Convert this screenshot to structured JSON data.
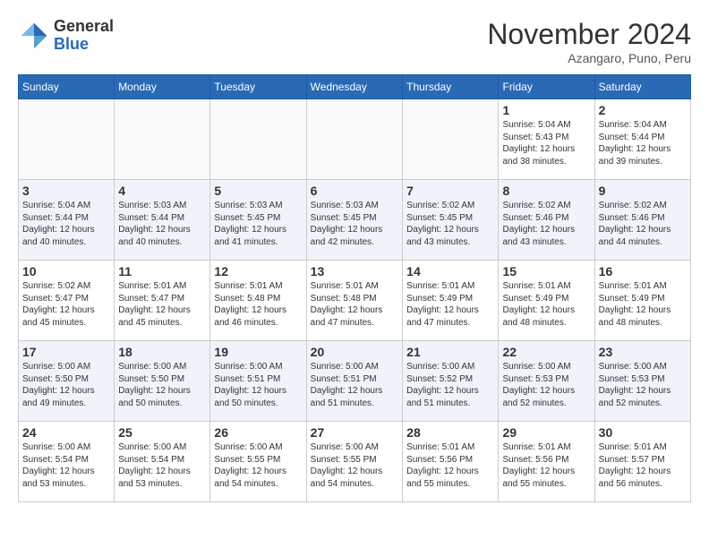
{
  "logo": {
    "general": "General",
    "blue": "Blue"
  },
  "title": "November 2024",
  "location": "Azangaro, Puno, Peru",
  "days_of_week": [
    "Sunday",
    "Monday",
    "Tuesday",
    "Wednesday",
    "Thursday",
    "Friday",
    "Saturday"
  ],
  "weeks": [
    [
      {
        "day": "",
        "info": ""
      },
      {
        "day": "",
        "info": ""
      },
      {
        "day": "",
        "info": ""
      },
      {
        "day": "",
        "info": ""
      },
      {
        "day": "",
        "info": ""
      },
      {
        "day": "1",
        "info": "Sunrise: 5:04 AM\nSunset: 5:43 PM\nDaylight: 12 hours and 38 minutes."
      },
      {
        "day": "2",
        "info": "Sunrise: 5:04 AM\nSunset: 5:44 PM\nDaylight: 12 hours and 39 minutes."
      }
    ],
    [
      {
        "day": "3",
        "info": "Sunrise: 5:04 AM\nSunset: 5:44 PM\nDaylight: 12 hours and 40 minutes."
      },
      {
        "day": "4",
        "info": "Sunrise: 5:03 AM\nSunset: 5:44 PM\nDaylight: 12 hours and 40 minutes."
      },
      {
        "day": "5",
        "info": "Sunrise: 5:03 AM\nSunset: 5:45 PM\nDaylight: 12 hours and 41 minutes."
      },
      {
        "day": "6",
        "info": "Sunrise: 5:03 AM\nSunset: 5:45 PM\nDaylight: 12 hours and 42 minutes."
      },
      {
        "day": "7",
        "info": "Sunrise: 5:02 AM\nSunset: 5:45 PM\nDaylight: 12 hours and 43 minutes."
      },
      {
        "day": "8",
        "info": "Sunrise: 5:02 AM\nSunset: 5:46 PM\nDaylight: 12 hours and 43 minutes."
      },
      {
        "day": "9",
        "info": "Sunrise: 5:02 AM\nSunset: 5:46 PM\nDaylight: 12 hours and 44 minutes."
      }
    ],
    [
      {
        "day": "10",
        "info": "Sunrise: 5:02 AM\nSunset: 5:47 PM\nDaylight: 12 hours and 45 minutes."
      },
      {
        "day": "11",
        "info": "Sunrise: 5:01 AM\nSunset: 5:47 PM\nDaylight: 12 hours and 45 minutes."
      },
      {
        "day": "12",
        "info": "Sunrise: 5:01 AM\nSunset: 5:48 PM\nDaylight: 12 hours and 46 minutes."
      },
      {
        "day": "13",
        "info": "Sunrise: 5:01 AM\nSunset: 5:48 PM\nDaylight: 12 hours and 47 minutes."
      },
      {
        "day": "14",
        "info": "Sunrise: 5:01 AM\nSunset: 5:49 PM\nDaylight: 12 hours and 47 minutes."
      },
      {
        "day": "15",
        "info": "Sunrise: 5:01 AM\nSunset: 5:49 PM\nDaylight: 12 hours and 48 minutes."
      },
      {
        "day": "16",
        "info": "Sunrise: 5:01 AM\nSunset: 5:49 PM\nDaylight: 12 hours and 48 minutes."
      }
    ],
    [
      {
        "day": "17",
        "info": "Sunrise: 5:00 AM\nSunset: 5:50 PM\nDaylight: 12 hours and 49 minutes."
      },
      {
        "day": "18",
        "info": "Sunrise: 5:00 AM\nSunset: 5:50 PM\nDaylight: 12 hours and 50 minutes."
      },
      {
        "day": "19",
        "info": "Sunrise: 5:00 AM\nSunset: 5:51 PM\nDaylight: 12 hours and 50 minutes."
      },
      {
        "day": "20",
        "info": "Sunrise: 5:00 AM\nSunset: 5:51 PM\nDaylight: 12 hours and 51 minutes."
      },
      {
        "day": "21",
        "info": "Sunrise: 5:00 AM\nSunset: 5:52 PM\nDaylight: 12 hours and 51 minutes."
      },
      {
        "day": "22",
        "info": "Sunrise: 5:00 AM\nSunset: 5:53 PM\nDaylight: 12 hours and 52 minutes."
      },
      {
        "day": "23",
        "info": "Sunrise: 5:00 AM\nSunset: 5:53 PM\nDaylight: 12 hours and 52 minutes."
      }
    ],
    [
      {
        "day": "24",
        "info": "Sunrise: 5:00 AM\nSunset: 5:54 PM\nDaylight: 12 hours and 53 minutes."
      },
      {
        "day": "25",
        "info": "Sunrise: 5:00 AM\nSunset: 5:54 PM\nDaylight: 12 hours and 53 minutes."
      },
      {
        "day": "26",
        "info": "Sunrise: 5:00 AM\nSunset: 5:55 PM\nDaylight: 12 hours and 54 minutes."
      },
      {
        "day": "27",
        "info": "Sunrise: 5:00 AM\nSunset: 5:55 PM\nDaylight: 12 hours and 54 minutes."
      },
      {
        "day": "28",
        "info": "Sunrise: 5:01 AM\nSunset: 5:56 PM\nDaylight: 12 hours and 55 minutes."
      },
      {
        "day": "29",
        "info": "Sunrise: 5:01 AM\nSunset: 5:56 PM\nDaylight: 12 hours and 55 minutes."
      },
      {
        "day": "30",
        "info": "Sunrise: 5:01 AM\nSunset: 5:57 PM\nDaylight: 12 hours and 56 minutes."
      }
    ]
  ]
}
